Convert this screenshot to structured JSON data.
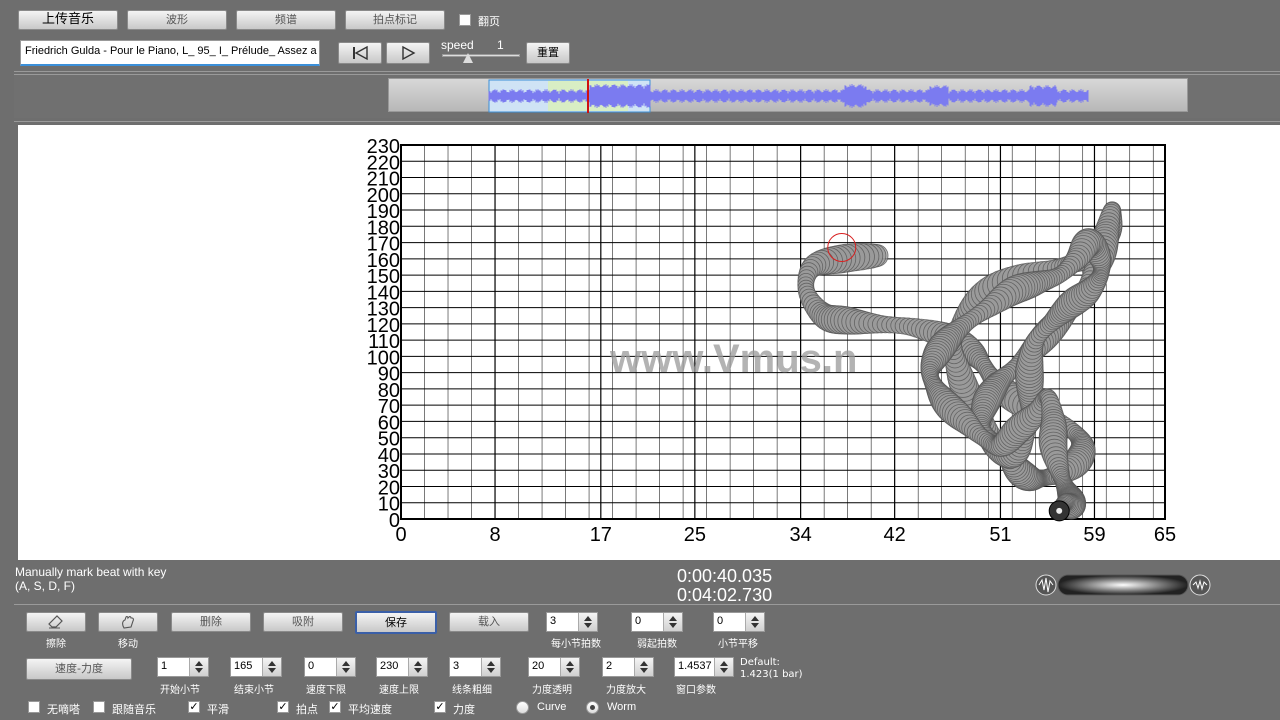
{
  "toolbar": {
    "upload": "上传音乐",
    "waveform": "波形",
    "spectrum": "频谱",
    "beat_mark": "拍点标记",
    "page_turn": "翻页",
    "track_name": "Friedrich Gulda - Pour le Piano, L_ 95_ I_ Prélude_ Assez a",
    "speed_label": "speed",
    "speed_value": "1",
    "reset": "重置"
  },
  "status": {
    "hint_line1": "Manually mark beat with key",
    "hint_line2": "(A, S, D, F)",
    "time_current": "0:00:40.035",
    "time_total": "0:04:02.730"
  },
  "watermark": "www.Vmus.n",
  "chart_data": {
    "type": "scatter",
    "x_ticks": [
      "0",
      "8",
      "17",
      "25",
      "34",
      "42",
      "51",
      "59",
      "65"
    ],
    "y_ticks": [
      "0",
      "10",
      "20",
      "30",
      "40",
      "50",
      "60",
      "70",
      "80",
      "90",
      "100",
      "110",
      "120",
      "130",
      "140",
      "150",
      "160",
      "170",
      "180",
      "190",
      "200",
      "210",
      "220",
      "230"
    ],
    "xlim": [
      0,
      65
    ],
    "ylim": [
      0,
      230
    ],
    "grid": true,
    "x": [
      40.5,
      37.5,
      35,
      34.5,
      36,
      38,
      40.5,
      43.5,
      46.5,
      48.5,
      49.5,
      50.5,
      52,
      54.5,
      57,
      58,
      57.5,
      56,
      54.5,
      53.5,
      52.5,
      51.5,
      50,
      48.5,
      47.5,
      47,
      48,
      50,
      53,
      56,
      58,
      59.5,
      60.5,
      60.5,
      60,
      59.5,
      58.5,
      57,
      55.5,
      54,
      52.5,
      51,
      50,
      49.5,
      49.5,
      50.5,
      52,
      53,
      53.5,
      53.5,
      53.5,
      54,
      55.5,
      57,
      58.5,
      59.5,
      59.5,
      58.5,
      57.5,
      56,
      54,
      52,
      50,
      48,
      46.5,
      45.5,
      45,
      45.5,
      46.5,
      48,
      49.5,
      51,
      52.5,
      54,
      55,
      55.5,
      55.5,
      56,
      56.5,
      57,
      57,
      56.5,
      56
    ],
    "y": [
      162,
      160,
      155,
      140,
      125,
      122,
      120,
      118,
      112,
      103,
      95,
      85,
      75,
      65,
      55,
      45,
      35,
      28,
      25,
      25,
      30,
      40,
      55,
      72,
      90,
      108,
      125,
      140,
      150,
      155,
      160,
      170,
      180,
      190,
      175,
      160,
      145,
      130,
      118,
      106,
      95,
      85,
      75,
      65,
      55,
      45,
      40,
      50,
      65,
      80,
      95,
      110,
      122,
      132,
      140,
      150,
      160,
      170,
      160,
      150,
      145,
      140,
      130,
      120,
      110,
      100,
      90,
      80,
      70,
      60,
      50,
      45,
      55,
      65,
      75,
      60,
      45,
      30,
      20,
      12,
      8,
      10,
      5
    ]
  },
  "controls": {
    "erase": "擦除",
    "move": "移动",
    "delete": "删除",
    "snap": "吸附",
    "save": "保存",
    "load": "载入",
    "beats_per_bar_value": "3",
    "beats_per_bar_label": "每小节拍数",
    "pickup_value": "0",
    "pickup_label": "弱起拍数",
    "bar_offset_value": "0",
    "bar_offset_label": "小节平移",
    "tempo_dynamics": "速度-力度",
    "start_bar_value": "1",
    "start_bar_label": "开始小节",
    "end_bar_value": "165",
    "end_bar_label": "结束小节",
    "speed_min_value": "0",
    "speed_min_label": "速度下限",
    "speed_max_value": "230",
    "speed_max_label": "速度上限",
    "line_width_value": "3",
    "line_width_label": "线条粗细",
    "dyn_alpha_value": "20",
    "dyn_alpha_label": "力度透明",
    "dyn_scale_value": "2",
    "dyn_scale_label": "力度放大",
    "window_value": "1.4537",
    "window_label": "窗口参数",
    "default_line1": "Default:",
    "default_line2": "1.423(1 bar)",
    "no_ticks": "无嘀嗒",
    "follow_music": "跟随音乐",
    "smooth": "平滑",
    "beat_point": "拍点",
    "avg_speed": "平均速度",
    "dynamics": "力度",
    "curve": "Curve",
    "worm": "Worm"
  }
}
